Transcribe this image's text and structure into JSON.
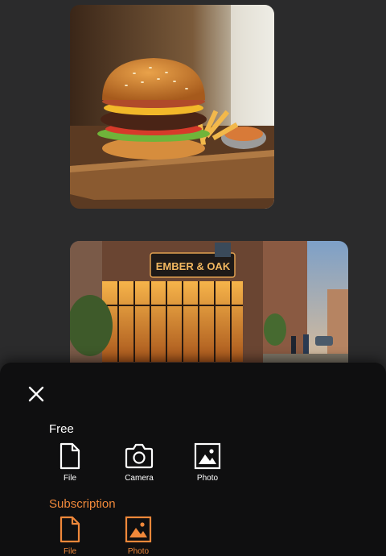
{
  "feed": {
    "images": [
      {
        "name": "burger-photo"
      },
      {
        "name": "restaurant-photo",
        "sign_text": "EMBER & OAK"
      }
    ]
  },
  "sheet": {
    "close_icon": "close-icon",
    "free": {
      "title": "Free",
      "options": [
        {
          "label": "File",
          "icon": "file-icon"
        },
        {
          "label": "Camera",
          "icon": "camera-icon"
        },
        {
          "label": "Photo",
          "icon": "image-icon"
        }
      ]
    },
    "subscription": {
      "title": "Subscription",
      "accent": "#f0883a",
      "options": [
        {
          "label": "File",
          "icon": "file-icon"
        },
        {
          "label": "Photo",
          "icon": "image-icon"
        }
      ]
    }
  }
}
